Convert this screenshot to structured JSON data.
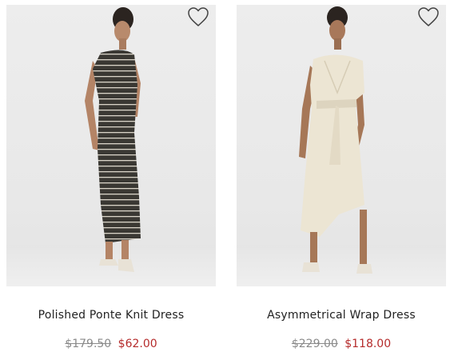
{
  "products": [
    {
      "name": "Polished Ponte Knit Dress",
      "original_price": "$179.50",
      "sale_price": "$62.00",
      "image_icon": "product-photo-striped-knit-dress",
      "wishlist_icon": "heart-outline-icon"
    },
    {
      "name": "Asymmetrical Wrap Dress",
      "original_price": "$229.00",
      "sale_price": "$118.00",
      "image_icon": "product-photo-wrap-dress",
      "wishlist_icon": "heart-outline-icon"
    }
  ],
  "colors": {
    "sale_price": "#b52b2b",
    "original_price": "#8a8a8a",
    "image_background": "#ebebeb"
  }
}
